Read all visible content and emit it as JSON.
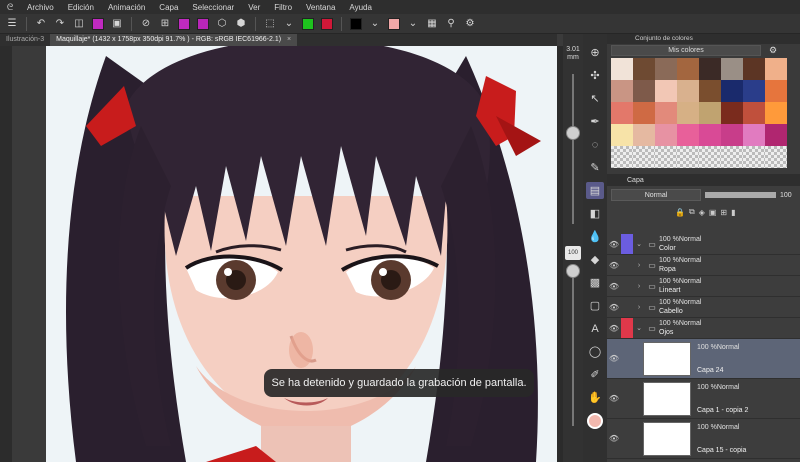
{
  "menu": [
    "Archivo",
    "Edición",
    "Animación",
    "Capa",
    "Seleccionar",
    "Ver",
    "Filtro",
    "Ventana",
    "Ayuda"
  ],
  "tabs": [
    {
      "label": "Ilustración-3"
    },
    {
      "label": "Maquillaje* (1432 x 1758px 350dpi 91.7% ) - RGB: sRGB IEC61966-2.1)",
      "close": "×"
    }
  ],
  "brush": {
    "size": "3.01",
    "unit": "mm",
    "opacity": "100"
  },
  "color_panel": {
    "title": "Conjunto de colores",
    "set_name": "Mis colores"
  },
  "swatches": [
    "#f1e3d8",
    "#6e4a32",
    "#8a6a58",
    "#a3663f",
    "#3b2a26",
    "#9a8f86",
    "#5c3524",
    "#f0b08a",
    "#c99584",
    "#7e5a4a",
    "#f2c7b5",
    "#d9b18e",
    "#7a4e2e",
    "#1a2a6c",
    "#2a3d8a",
    "#e6753d",
    "#e3786a",
    "#cf6a44",
    "#e28a7b",
    "#d6b085",
    "#c0a370",
    "#7a2b1d",
    "#c0503c",
    "#ff9a3a",
    "#f7e3a8",
    "#e5b9a1",
    "#e792a3",
    "#e8609a",
    "#d94a96",
    "#c83d8a",
    "#e17bc0",
    "#b02670",
    "trans",
    "trans",
    "trans",
    "trans",
    "trans",
    "trans",
    "trans",
    "trans"
  ],
  "layer_panel": {
    "title": "Capa",
    "blend_mode": "Normal",
    "opacity": "100",
    "layers": [
      {
        "pct": "100 %Normal",
        "name": "Color",
        "type": "folder",
        "marks": [
          "purple",
          "purple"
        ]
      },
      {
        "pct": "100 %Normal",
        "name": "Ropa",
        "type": "folder"
      },
      {
        "pct": "100 %Normal",
        "name": "Lineart",
        "type": "folder"
      },
      {
        "pct": "100 %Normal",
        "name": "Cabello",
        "type": "folder"
      },
      {
        "pct": "100 %Normal",
        "name": "Ojos",
        "type": "folder",
        "marks": [
          "red",
          "red"
        ]
      },
      {
        "pct": "100 %Normal",
        "name": "Capa 24",
        "type": "raster",
        "selected": true
      },
      {
        "pct": "100 %Normal",
        "name": "Capa 1 - copia 2",
        "type": "raster"
      },
      {
        "pct": "100 %Normal",
        "name": "Capa 15 - copia",
        "type": "raster"
      }
    ]
  },
  "toast": "Se ha detenido y guardado la grabación de pantalla.",
  "colors": {
    "main_color": "#f2b8ae",
    "sub_color": "#ffffff",
    "accent": "#5d6577"
  }
}
